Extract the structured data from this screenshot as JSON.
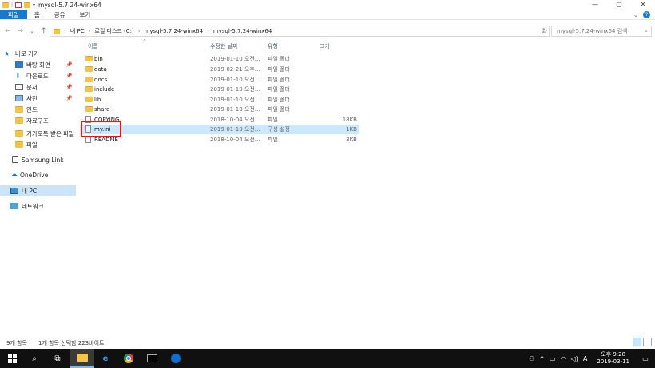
{
  "window": {
    "title": "mysql-5.7.24-winx64",
    "controls": [
      "—",
      "▢",
      "✕"
    ]
  },
  "ribbon": {
    "tabs": [
      "파일",
      "홈",
      "공유",
      "보기"
    ]
  },
  "address": {
    "back": "←",
    "forward": "→",
    "recent": "⌄",
    "up": "↑",
    "crumbs": [
      "내 PC",
      "로컬 디스크 (C:)",
      "mysql-5.7.24-winx64",
      "mysql-5.7.24-winx64"
    ],
    "search_placeholder": "mysql-5.7.24-winx64 검색"
  },
  "sidebar": {
    "items": [
      {
        "label": "바로 가기",
        "icon": "star-icon"
      },
      {
        "label": "바탕 화면",
        "icon": "desktop-icon",
        "pinned": true
      },
      {
        "label": "다운로드",
        "icon": "download-icon",
        "pinned": true
      },
      {
        "label": "문서",
        "icon": "document-icon",
        "pinned": true
      },
      {
        "label": "사진",
        "icon": "pictures-icon",
        "pinned": true
      },
      {
        "label": "안드",
        "icon": "folder-icon"
      },
      {
        "label": "자료구조",
        "icon": "folder-icon"
      },
      {
        "label": "카카오톡 받은 파일",
        "icon": "folder-icon"
      },
      {
        "label": "파일",
        "icon": "folder-icon"
      },
      {
        "label": "Samsung Link",
        "icon": "samsung-link-icon"
      },
      {
        "label": "OneDrive",
        "icon": "onedrive-icon"
      },
      {
        "label": "내 PC",
        "icon": "pc-icon",
        "selected": true
      },
      {
        "label": "네트워크",
        "icon": "network-icon"
      }
    ]
  },
  "columns": [
    "이름",
    "수정한 날짜",
    "유형",
    "크기"
  ],
  "files": [
    {
      "name": "bin",
      "date": "2019-01-10 오전...",
      "type": "파일 폴더",
      "size": "",
      "kind": "folder"
    },
    {
      "name": "data",
      "date": "2019-02-21 오후...",
      "type": "파일 폴더",
      "size": "",
      "kind": "folder"
    },
    {
      "name": "docs",
      "date": "2019-01-10 오전...",
      "type": "파일 폴더",
      "size": "",
      "kind": "folder"
    },
    {
      "name": "include",
      "date": "2019-01-10 오전...",
      "type": "파일 폴더",
      "size": "",
      "kind": "folder"
    },
    {
      "name": "lib",
      "date": "2019-01-10 오전...",
      "type": "파일 폴더",
      "size": "",
      "kind": "folder"
    },
    {
      "name": "share",
      "date": "2019-01-10 오전...",
      "type": "파일 폴더",
      "size": "",
      "kind": "folder"
    },
    {
      "name": "COPYING",
      "date": "2018-10-04 오전...",
      "type": "파일",
      "size": "18KB",
      "kind": "file"
    },
    {
      "name": "my.ini",
      "date": "2019-01-10 오전...",
      "type": "구성 설정",
      "size": "1KB",
      "kind": "ini",
      "selected": true
    },
    {
      "name": "README",
      "date": "2018-10-04 오전...",
      "type": "파일",
      "size": "3KB",
      "kind": "file"
    }
  ],
  "status": {
    "count": "9개 항목",
    "selection": "1개 항목 선택함 223바이트"
  },
  "taskbar": {
    "apps": [
      "start-icon",
      "search-icon",
      "task-view-icon",
      "file-explorer-icon",
      "edge-icon",
      "chrome-icon",
      "cmd-icon",
      "teamviewer-icon"
    ],
    "tray_input": "A",
    "time": "오후 9:28",
    "date": "2019-03-11"
  },
  "colors": {
    "accent": "#1979ca",
    "selection": "#cce8ff",
    "highlight_box": "#e0191b",
    "taskbar": "#101010"
  }
}
